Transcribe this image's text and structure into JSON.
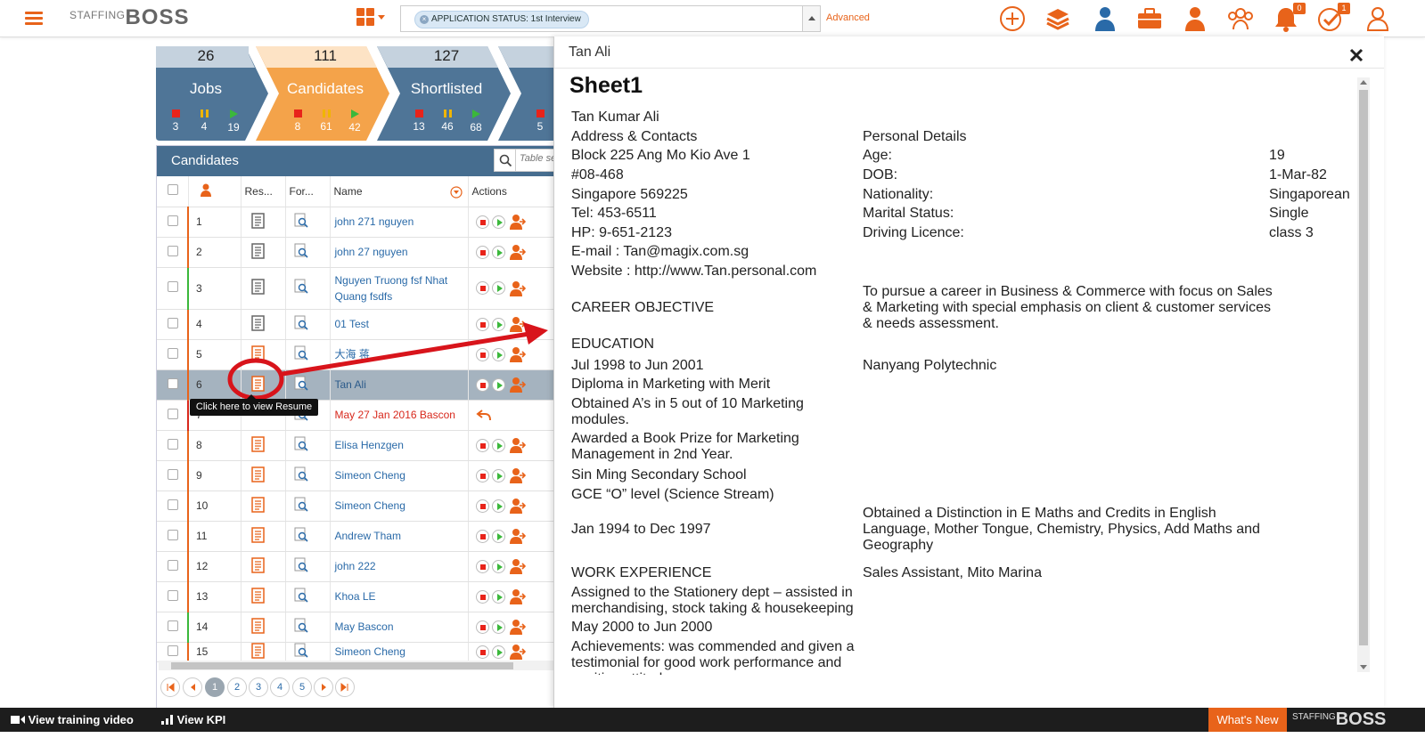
{
  "app": {
    "logo_small": "STAFFING",
    "logo_big": "BOSS"
  },
  "search": {
    "chip_text": "APPLICATION STATUS: 1st Interview",
    "advanced_label": "Advanced"
  },
  "top_icons": [
    {
      "name": "add-icon"
    },
    {
      "name": "layers-icon"
    },
    {
      "name": "user-icon"
    },
    {
      "name": "briefcase-icon"
    },
    {
      "name": "candidate-icon"
    },
    {
      "name": "group-icon"
    },
    {
      "name": "bell-icon",
      "badge": "0"
    },
    {
      "name": "tasks-icon",
      "badge": "1"
    },
    {
      "name": "profile-icon"
    }
  ],
  "stages": [
    {
      "count": "26",
      "label": "Jobs",
      "stop": "3",
      "pause": "4",
      "play": "19",
      "color": "#4f7597"
    },
    {
      "count": "111",
      "label": "Candidates",
      "stop": "8",
      "pause": "61",
      "play": "42",
      "color": "#f4a34a"
    },
    {
      "count": "127",
      "label": "Shortlisted",
      "stop": "13",
      "pause": "46",
      "play": "68",
      "color": "#4f7597"
    },
    {
      "count": "",
      "label": "",
      "stop": "5",
      "pause": "",
      "play": "",
      "color": "#4f7597"
    }
  ],
  "panel": {
    "title": "Candidates",
    "search_placeholder": "Table search",
    "columns": {
      "resume": "Res...",
      "form": "For...",
      "name": "Name",
      "actions": "Actions"
    },
    "rows": [
      {
        "num": "1",
        "name": "john 271 nguyen",
        "resume": "gray"
      },
      {
        "num": "2",
        "name": "john 27 nguyen",
        "resume": "gray"
      },
      {
        "num": "3",
        "name": "Nguyen Truong fsf Nhat Quang fsdfs",
        "resume": "gray"
      },
      {
        "num": "4",
        "name": "01 Test",
        "resume": "gray"
      },
      {
        "num": "5",
        "name": "大海 蒋",
        "resume": "orange"
      },
      {
        "num": "6",
        "name": "Tan Ali",
        "resume": "orange"
      },
      {
        "num": "7",
        "name": "May 27 Jan 2016 Bascon",
        "resume": "none"
      },
      {
        "num": "8",
        "name": "Elisa Henzgen",
        "resume": "orange"
      },
      {
        "num": "9",
        "name": "Simeon Cheng",
        "resume": "orange"
      },
      {
        "num": "10",
        "name": "Simeon Cheng",
        "resume": "orange"
      },
      {
        "num": "11",
        "name": "Andrew Tham",
        "resume": "orange"
      },
      {
        "num": "12",
        "name": "john 222",
        "resume": "orange"
      },
      {
        "num": "13",
        "name": "Khoa LE",
        "resume": "orange"
      },
      {
        "num": "14",
        "name": "May Bascon",
        "resume": "orange"
      },
      {
        "num": "15",
        "name": "Simeon Cheng",
        "resume": "orange"
      }
    ],
    "tooltip": "Click here to view Resume",
    "pages": [
      "1",
      "2",
      "3",
      "4",
      "5"
    ]
  },
  "modal": {
    "title": "Tan Ali",
    "sheet_title": "Sheet1",
    "left": {
      "name": "Tan Kumar Ali",
      "address_heading": "Address & Contacts",
      "addr1": "Block 225 Ang Mo Kio Ave 1",
      "addr2": "#08-468",
      "addr3": "Singapore 569225",
      "tel": "Tel: 453-6511",
      "hp": "HP: 9-651-2123",
      "email": "E-mail : Tan@magix.com.sg",
      "website": "Website : http://www.Tan.personal.com",
      "career_heading": "CAREER OBJECTIVE",
      "education_heading": "EDUCATION",
      "edu1_dates": "Jul 1998 to Jun 2001",
      "edu1_diploma": "Diploma in Marketing with Merit",
      "edu1_obtained": "Obtained A’s in 5 out of 10 Marketing modules.",
      "edu1_award": "Awarded a Book Prize for Marketing Management in 2nd Year.",
      "edu2_school": "Sin Ming Secondary School",
      "edu2_level": "GCE “O” level (Science Stream)",
      "edu2_dates": "Jan 1994 to Dec 1997",
      "work_heading": "WORK EXPERIENCE",
      "work1": "Assigned to the Stationery dept – assisted in merchandising, stock taking & housekeeping",
      "work2": "May 2000 to Jun 2000",
      "work3": "Achievements: was commended and given a testimonial for good work performance and positive attitude"
    },
    "right": {
      "personal_heading": "Personal Details",
      "age_label": "Age:",
      "age": "19",
      "dob_label": "DOB:",
      "dob": "1-Mar-82",
      "nationality_label": "Nationality:",
      "nationality": "Singaporean",
      "marital_label": "Marital Status:",
      "marital": "Single",
      "licence_label": "Driving Licence:",
      "licence": "class 3",
      "career_text": "To pursue a career in Business & Commerce with focus on Sales & Marketing with special emphasis on client & customer services & needs assessment.",
      "edu1_school": "Nanyang Polytechnic",
      "edu2_text": "Obtained a Distinction in E Maths and Credits in English Language, Mother Tongue, Chemistry, Physics, Add Maths and Geography",
      "work_job": "Sales Assistant, Mito Marina"
    }
  },
  "footer": {
    "training_label": "View training video",
    "kpi_label": "View KPI",
    "whats_new": "What's New",
    "logo_small": "STAFFING",
    "logo_big": "BOSS"
  },
  "colors": {
    "accent": "#e8631a",
    "header_blue": "#466d8f",
    "link": "#2a6aa8"
  }
}
